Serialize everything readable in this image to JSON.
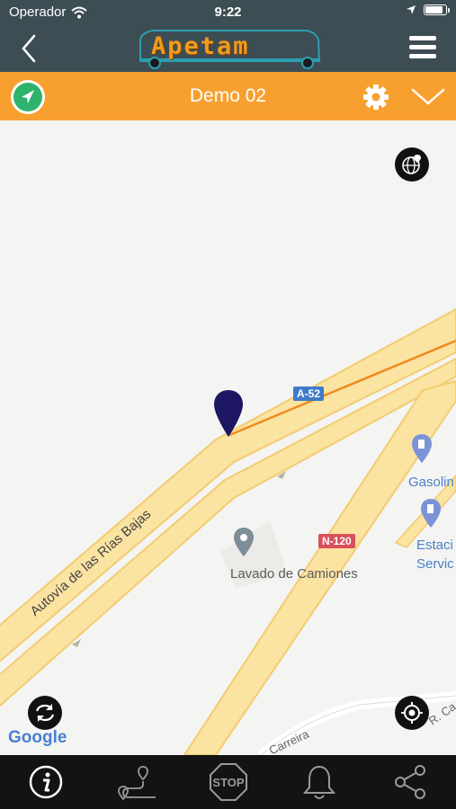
{
  "status_bar": {
    "carrier": "Operador",
    "time": "9:22",
    "wifi_icon": "wifi-icon",
    "location_icon": "location-arrow-icon",
    "battery_icon": "battery-icon"
  },
  "nav": {
    "back_icon": "chevron-left-icon",
    "logo_text": "Apetam",
    "menu_icon": "hamburger-menu-icon"
  },
  "vehicle_bar": {
    "title": "Demo 02",
    "location_icon": "locate-vehicle-icon",
    "settings_icon": "gear-icon",
    "expand_icon": "chevron-down-icon",
    "accent": "#f8a02f",
    "location_btn_color": "#2db36c"
  },
  "map": {
    "road_name": "Autovía de las Rías Bajas",
    "shield_a52": "A-52",
    "shield_n120": "N-120",
    "poi_washer": "Lavado de Camiones",
    "poi_gas_1": "Gasolin",
    "poi_gas_2a": "Estaci",
    "poi_gas_2b": "Servic",
    "street_1": "Carreira",
    "street_2": "R. Ca",
    "attribution": "Google",
    "marker_color": "#1c1663",
    "layers_icon": "globe-pin-icon",
    "refresh_icon": "refresh-icon",
    "center_icon": "crosshair-icon",
    "gas_icon": "gas-station-icon",
    "poi_icon": "map-pin-icon"
  },
  "toolbar": {
    "items": [
      {
        "icon": "info-icon"
      },
      {
        "icon": "route-icon"
      },
      {
        "icon": "stop-sign-icon",
        "label": "STOP"
      },
      {
        "icon": "bell-icon"
      },
      {
        "icon": "share-icon"
      }
    ]
  }
}
